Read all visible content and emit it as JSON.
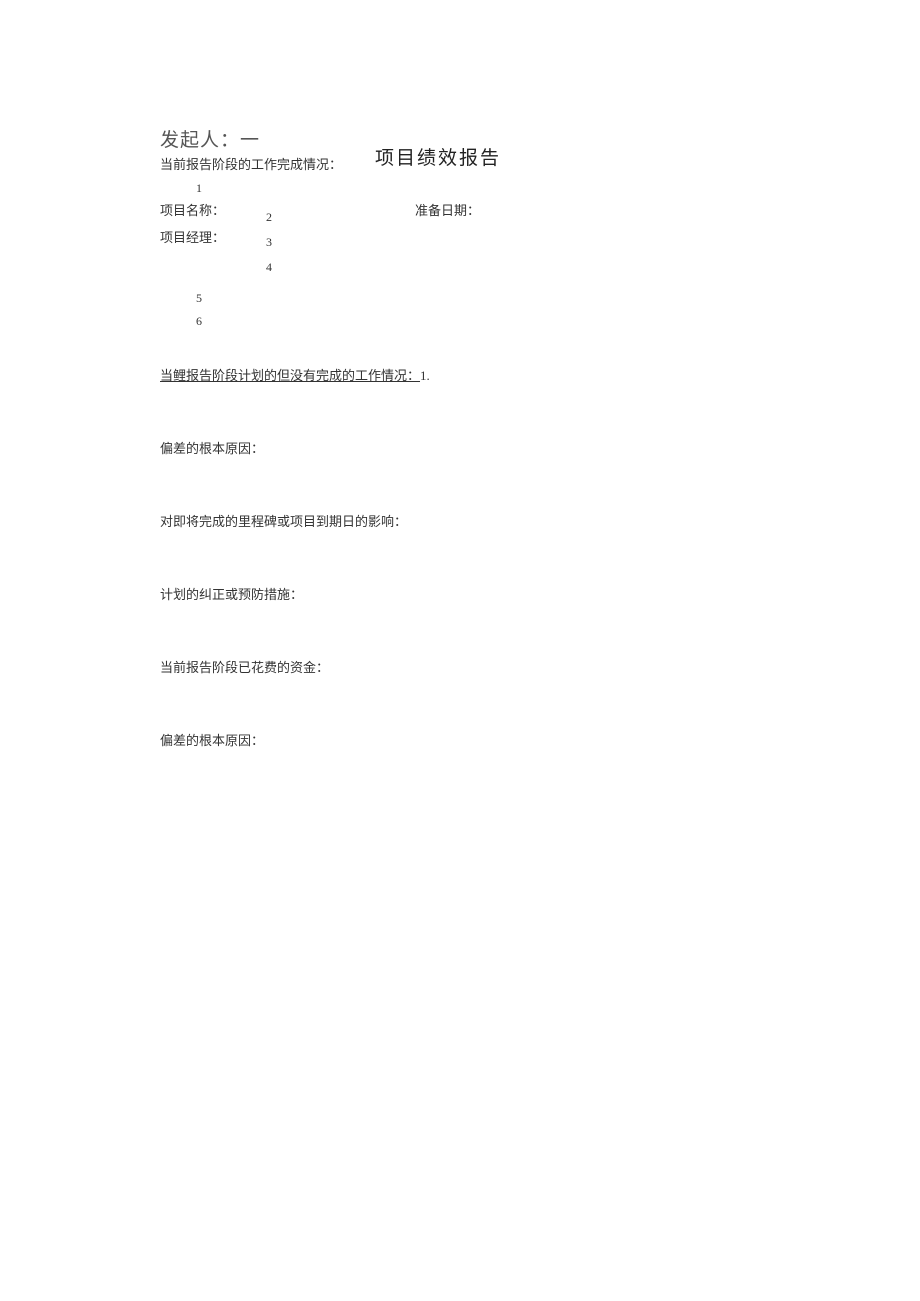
{
  "initiator_label": "发起人：一",
  "subtitle_completed": "当前报告阶段的工作完成情况：",
  "title": "项目绩效报告",
  "numbers": {
    "n1": "1",
    "n2": "2",
    "n3": "3",
    "n4": "4",
    "n5": "5",
    "n6": "6"
  },
  "project_name_label": "项目名称：",
  "prepare_date_label": "准备日期：",
  "project_manager_label": "项目经理：",
  "section_incomplete_underlined": "当鲤报告阶段计划的但没有完成的工作情况：",
  "section_incomplete_suffix": "1.",
  "section_root_cause": "偏差的根本原因：",
  "section_milestone_impact": "对即将完成的里程碑或项目到期日的影响：",
  "section_corrective": "计划的纠正或预防措施：",
  "section_funds_spent": "当前报告阶段已花费的资金：",
  "section_root_cause2": "偏差的根本原因："
}
